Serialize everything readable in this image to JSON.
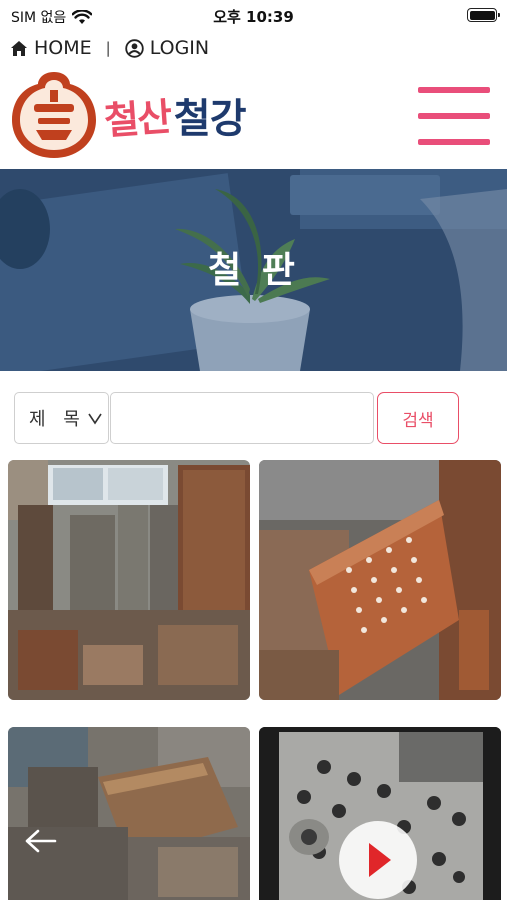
{
  "status_bar": {
    "carrier": "SIM 없음",
    "time": "오후 10:39"
  },
  "top_links": {
    "home": "HOME",
    "separator": "|",
    "login": "LOGIN"
  },
  "header": {
    "logo_text_red": "철산",
    "logo_text_navy": "철강"
  },
  "banner": {
    "title": "철 판"
  },
  "search": {
    "select_value": "제 목",
    "input_value": "",
    "button_label": "검색"
  },
  "colors": {
    "accent_pink": "#e94e7a",
    "brand_red": "#e94e67",
    "brand_navy": "#1e3a6d"
  },
  "gallery": {
    "items": [
      {
        "kind": "photo",
        "subject": "steel-plate-stacks-warehouse"
      },
      {
        "kind": "photo",
        "subject": "perforated-steel-plates"
      },
      {
        "kind": "photo",
        "subject": "steel-blocks-pile"
      },
      {
        "kind": "video",
        "subject": "drilled-steel-plate"
      }
    ]
  },
  "icons": {
    "wifi": "wifi-icon",
    "home": "home-icon",
    "user": "user-circle-icon",
    "menu": "hamburger-menu-icon",
    "play": "play-icon",
    "back": "arrow-left-icon"
  }
}
